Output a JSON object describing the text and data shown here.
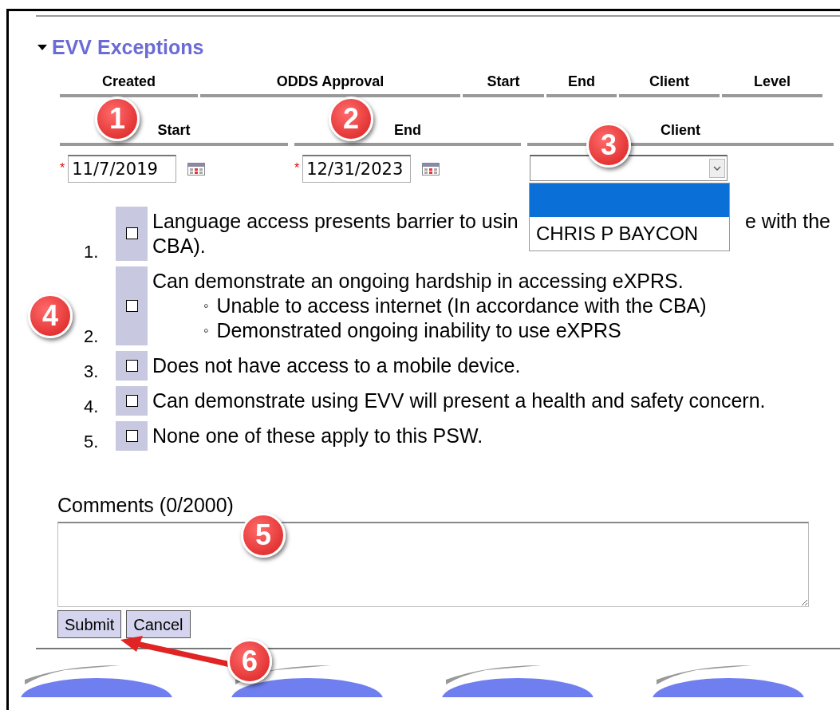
{
  "section": {
    "title": "EVV Exceptions",
    "expanded": true
  },
  "table_columns": [
    "Created",
    "ODDS Approval",
    "Start",
    "End",
    "Client",
    "Level"
  ],
  "filters": [
    {
      "kind": "date",
      "label": "Start",
      "marker": "*",
      "value": "11/7/2019"
    },
    {
      "kind": "date",
      "label": "End",
      "marker": "*",
      "value": "12/31/2023"
    },
    {
      "kind": "select",
      "label": "Client",
      "expanded": true,
      "options": [
        {
          "selected": true
        },
        {
          "label": "CHRIS P BAYCON",
          "selected": false
        }
      ]
    }
  ],
  "exceptions": [
    {
      "number": "1.",
      "checked": false,
      "text": "Language access presents barrier to usin",
      "text_after": "e with the",
      "text_end": "CBA)."
    },
    {
      "number": "2.",
      "checked": false,
      "text": "Can demonstrate an ongoing hardship in accessing eXPRS.",
      "sub": [
        {
          "marker": "◦",
          "text": "Unable to access internet (In accordance with the CBA)"
        },
        {
          "marker": "◦",
          "text": "Demonstrated ongoing inability to use eXPRS"
        }
      ]
    },
    {
      "number": "3.",
      "checked": false,
      "text": "Does not have access to a mobile device."
    },
    {
      "number": "4.",
      "checked": false,
      "text": "Can demonstrate using EVV will present a health and safety concern."
    },
    {
      "number": "5.",
      "checked": false,
      "text": "None one of these apply to this PSW."
    }
  ],
  "comments": {
    "label": "Comments (0/2000)"
  },
  "buttons": [
    "Submit",
    "Cancel"
  ],
  "callouts": [
    "1",
    "2",
    "3",
    "4",
    "5",
    "6"
  ]
}
